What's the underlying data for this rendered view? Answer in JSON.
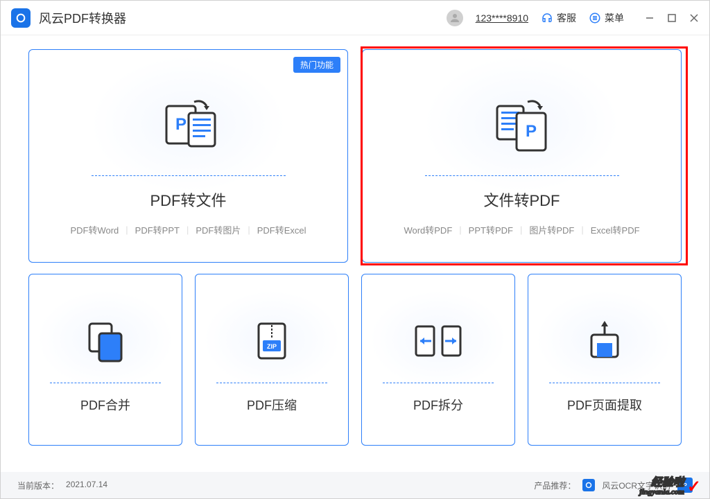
{
  "app": {
    "title": "风云PDF转换器"
  },
  "header": {
    "user_id": "123****8910",
    "support": "客服",
    "menu": "菜单"
  },
  "cards": {
    "pdf_to_file": {
      "title": "PDF转文件",
      "hot_tag": "热门功能",
      "subs": [
        "PDF转Word",
        "PDF转PPT",
        "PDF转图片",
        "PDF转Excel"
      ]
    },
    "file_to_pdf": {
      "title": "文件转PDF",
      "subs": [
        "Word转PDF",
        "PPT转PDF",
        "图片转PDF",
        "Excel转PDF"
      ]
    },
    "merge": {
      "title": "PDF合并"
    },
    "compress": {
      "title": "PDF压缩",
      "zip_label": "ZIP"
    },
    "split": {
      "title": "PDF拆分"
    },
    "extract": {
      "title": "PDF页面提取"
    }
  },
  "statusbar": {
    "version_label": "当前版本：",
    "version": "2021.07.14",
    "recommend_label": "产品推荐：",
    "recommend1": "风云OCR文字识别"
  },
  "watermark": {
    "text1": "经验啦",
    "text2": "jingyanla.com"
  }
}
